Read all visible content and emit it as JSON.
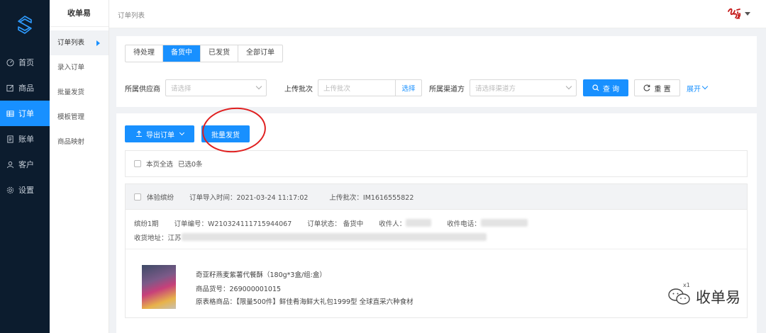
{
  "sidebar": {
    "items": [
      {
        "label": "首页",
        "icon": "dashboard-icon"
      },
      {
        "label": "商品",
        "icon": "edit-icon"
      },
      {
        "label": "订单",
        "icon": "table-icon"
      },
      {
        "label": "账单",
        "icon": "bill-icon"
      },
      {
        "label": "客户",
        "icon": "user-icon"
      },
      {
        "label": "设置",
        "icon": "gear-icon"
      }
    ],
    "active": "订单",
    "accent": "#1890ff",
    "bg": "#0c1c2e"
  },
  "submenu": {
    "title": "收单易",
    "items": [
      "订单列表",
      "录入订单",
      "批量发货",
      "模板管理",
      "商品映射"
    ],
    "active": "订单列表"
  },
  "topbar": {
    "breadcrumb": "订单列表"
  },
  "tabs": [
    "待处理",
    "备货中",
    "已发货",
    "全部订单"
  ],
  "active_tab": "备货中",
  "filters": {
    "supplier_label": "所属供应商",
    "supplier_placeholder": "请选择",
    "batch_label": "上传批次",
    "batch_placeholder": "上传批次",
    "batch_select": "选择",
    "channel_label": "所属渠道方",
    "channel_placeholder": "请选择渠道方",
    "query": "查 询",
    "reset": "重 置",
    "expand": "展开"
  },
  "actions": {
    "export": "导出订单",
    "batch_ship": "批量发货"
  },
  "selection": {
    "select_all": "本页全选",
    "selected": "已选0条"
  },
  "order": {
    "group_name": "体验缤纷",
    "import_time": "订单导入时间：2021-03-24 11:17:02",
    "batch": "上传批次：IM1616555822",
    "period": "缤纷1期",
    "order_no": "订单编号：W210324111715944067",
    "status": "订单状态： 备货中",
    "receiver_label": "收件人：",
    "phone_label": "收件电话：",
    "address_label": "收货地址：江苏"
  },
  "goods": {
    "name": "奇亚籽燕麦紫薯代餐酥（180g*3盒/组:盒）",
    "sku": "商品货号：269000001015",
    "origin": "原表格商品：【限量500件】鲜佳肴海鲜大礼包1999型 全球直采六种食材"
  },
  "watermark": {
    "text": "收单易",
    "badge": "x1"
  }
}
